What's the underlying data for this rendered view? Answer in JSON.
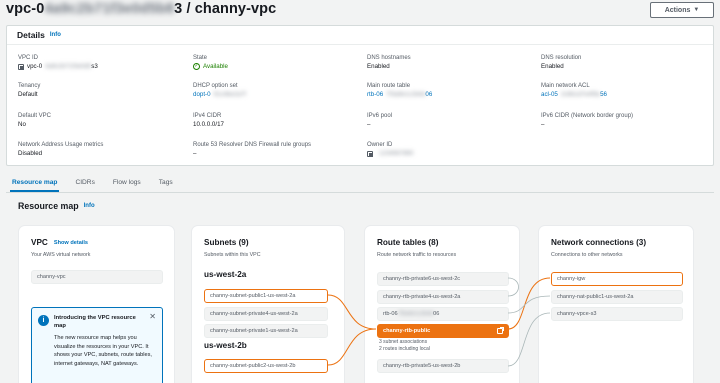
{
  "header": {
    "title_prefix": "vpc-0",
    "title_redacted": "4a9c2b71f3e0d5b8",
    "title_suffix": "3 / channy-vpc",
    "actions_label": "Actions"
  },
  "details": {
    "heading": "Details",
    "info": "Info",
    "fields": [
      {
        "label": "VPC ID",
        "value": "vpc-0",
        "redacted": "4a9c2b71f3e0d5",
        "suffix": "s3",
        "copy": true
      },
      {
        "label": "State",
        "value": "Available",
        "status": "ok"
      },
      {
        "label": "DNS hostnames",
        "value": "Enabled"
      },
      {
        "label": "DNS resolution",
        "value": "Enabled"
      },
      {
        "label": "Tenancy",
        "value": "Default"
      },
      {
        "label": "DHCP option set",
        "value": "dopt-0",
        "redacted": "91c4be2a7f",
        "link": true
      },
      {
        "label": "Main route table",
        "value": "rtb-06",
        "redacted": "7f3a9e1c2b4d",
        "suffix": "06",
        "link": true
      },
      {
        "label": "Main network ACL",
        "value": "acl-05",
        "redacted": "2c8b1d7e4f9a",
        "suffix": "56",
        "link": true
      },
      {
        "label": "Default VPC",
        "value": "No"
      },
      {
        "label": "IPv4 CIDR",
        "value": "10.0.0.0/17"
      },
      {
        "label": "IPv6 pool",
        "value": "–"
      },
      {
        "label": "IPv6 CIDR (Network border group)",
        "value": "–"
      },
      {
        "label": "Network Address Usage metrics",
        "value": "Disabled"
      },
      {
        "label": "Route 53 Resolver DNS Firewall rule groups",
        "value": "–"
      },
      {
        "label": "Owner ID",
        "value": "",
        "redacted": "1234567890",
        "copy": true
      }
    ]
  },
  "tabs": [
    "Resource map",
    "CIDRs",
    "Flow logs",
    "Tags"
  ],
  "resource_map": {
    "title": "Resource map",
    "info": "Info",
    "vpc": {
      "title": "VPC",
      "show_details": "Show details",
      "subtitle": "Your AWS virtual network",
      "item": "channy-vpc",
      "intro": {
        "title": "Introducing the VPC resource map",
        "body": "The new resource map helps you visualize the resources in your VPC. It shows your VPC, subnets, route tables, internet gateways, NAT gateways."
      }
    },
    "subnets": {
      "title": "Subnets (9)",
      "subtitle": "Subnets within this VPC",
      "regions": [
        {
          "name": "us-west-2a",
          "items": [
            "channy-subnet-public1-us-west-2a",
            "channy-subnet-private4-us-west-2a",
            "channy-subnet-private1-us-west-2a"
          ]
        },
        {
          "name": "us-west-2b",
          "items": [
            "channy-subnet-public2-us-west-2b"
          ]
        }
      ]
    },
    "route_tables": {
      "title": "Route tables (8)",
      "subtitle": "Route network traffic to resources",
      "items": [
        "channy-rtb-private6-us-west-2c",
        "channy-rtb-private4-us-west-2a",
        "rtb-06",
        "channy-rtb-public",
        "channy-rtb-private5-us-west-2b"
      ],
      "redacted_rtb": "7f3a9e1c2b4d",
      "redacted_suffix": "06",
      "assoc_line1": "3 subnet associations",
      "assoc_line2": "2 routes including local"
    },
    "network": {
      "title": "Network connections (3)",
      "subtitle": "Connections to other networks",
      "items": [
        "channy-igw",
        "channy-nat-public1-us-west-2a",
        "channy-vpce-s3"
      ]
    }
  },
  "colors": {
    "accent": "#ec7211",
    "link": "#0073bb",
    "ok": "#1d8102"
  }
}
